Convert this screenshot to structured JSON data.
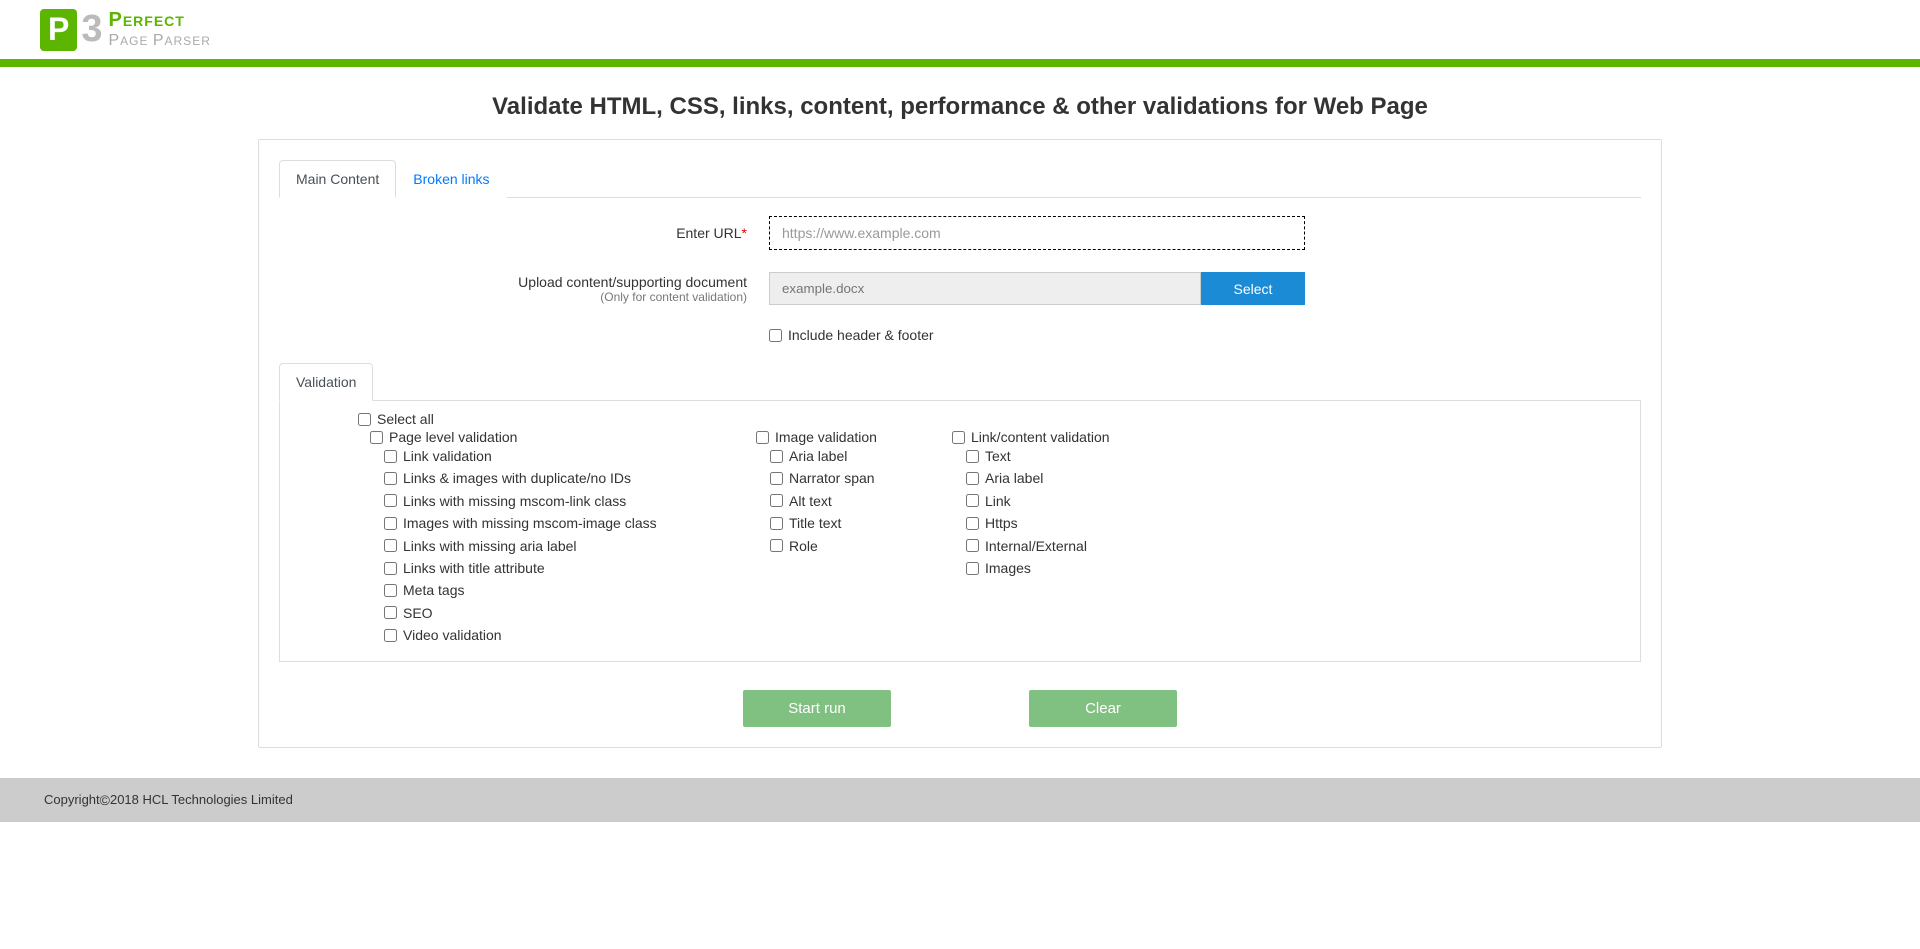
{
  "logo": {
    "p": "P",
    "three": "3",
    "line1_big": "P",
    "line1_rest": "ERFECT",
    "line2_bigP": "P",
    "line2_restP": "AGE ",
    "line2_bigR": "P",
    "line2_restR": "ARSER"
  },
  "title": "Validate HTML, CSS, links, content, performance & other validations for Web Page",
  "tabs": {
    "main": "Main Content",
    "broken": "Broken links"
  },
  "form": {
    "url_label": "Enter URL",
    "url_required": "*",
    "url_placeholder": "https://www.example.com",
    "upload_label": "Upload content/supporting document",
    "upload_sub": "(Only for content validation)",
    "upload_placeholder": "example.docx",
    "select_btn": "Select",
    "include_label": "Include header & footer"
  },
  "subtabs": {
    "validation": "Validation"
  },
  "select_all": "Select all",
  "col1": {
    "head": "Page level validation",
    "items": [
      "Link validation",
      "Links & images with duplicate/no IDs",
      "Links with missing mscom-link class",
      "Images with missing mscom-image class",
      "Links with missing aria label",
      "Links with title attribute",
      "Meta tags",
      "SEO",
      "Video validation"
    ]
  },
  "col2": {
    "head": "Image validation",
    "items": [
      "Aria label",
      "Narrator span",
      "Alt text",
      "Title text",
      "Role"
    ]
  },
  "col3": {
    "head": "Link/content validation",
    "items": [
      "Text",
      "Aria label",
      "Link",
      "Https",
      "Internal/External",
      "Images"
    ]
  },
  "actions": {
    "start": "Start run",
    "clear": "Clear"
  },
  "footer": {
    "prefix": "Copyright ",
    "year_company": " 2018 HCL Technologies Limited"
  }
}
